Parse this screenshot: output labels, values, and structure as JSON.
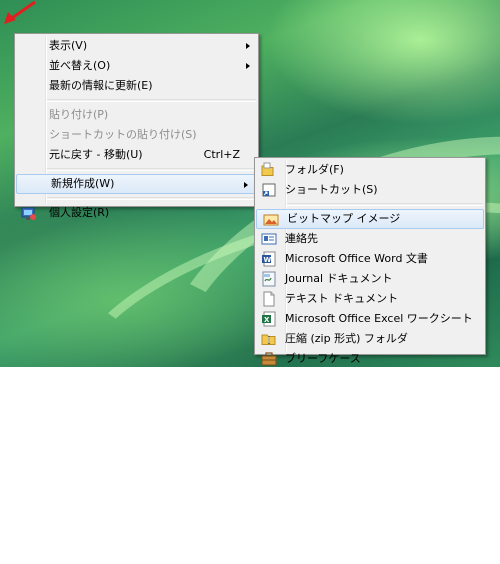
{
  "context_menu": {
    "items": [
      {
        "label": "表示(V)"
      },
      {
        "label": "並べ替え(O)"
      },
      {
        "label": "最新の情報に更新(E)"
      },
      {
        "label": "貼り付け(P)"
      },
      {
        "label": "ショートカットの貼り付け(S)"
      },
      {
        "label": "元に戻す - 移動(U)",
        "shortcut": "Ctrl+Z"
      },
      {
        "label": "新規作成(W)"
      },
      {
        "label": "個人設定(R)"
      }
    ]
  },
  "new_submenu": {
    "items": [
      {
        "label": "フォルダ(F)",
        "icon": "folder-icon"
      },
      {
        "label": "ショートカット(S)",
        "icon": "shortcut-icon"
      },
      {
        "label": "ビットマップ イメージ",
        "icon": "bitmap-icon"
      },
      {
        "label": "連絡先",
        "icon": "contact-icon"
      },
      {
        "label": "Microsoft Office Word 文書",
        "icon": "word-icon"
      },
      {
        "label": "Journal ドキュメント",
        "icon": "journal-icon"
      },
      {
        "label": "テキスト ドキュメント",
        "icon": "text-document-icon"
      },
      {
        "label": "Microsoft Office Excel ワークシート",
        "icon": "excel-icon"
      },
      {
        "label": "圧縮 (zip 形式) フォルダ",
        "icon": "zip-folder-icon"
      },
      {
        "label": "ブリーフケース",
        "icon": "briefcase-icon"
      }
    ]
  },
  "colors": {
    "menu_background": "#f0f0f0",
    "selection_border": "#a8cbef",
    "disabled_text": "#8d8d8d",
    "cursor_arrow": "#e02020"
  }
}
